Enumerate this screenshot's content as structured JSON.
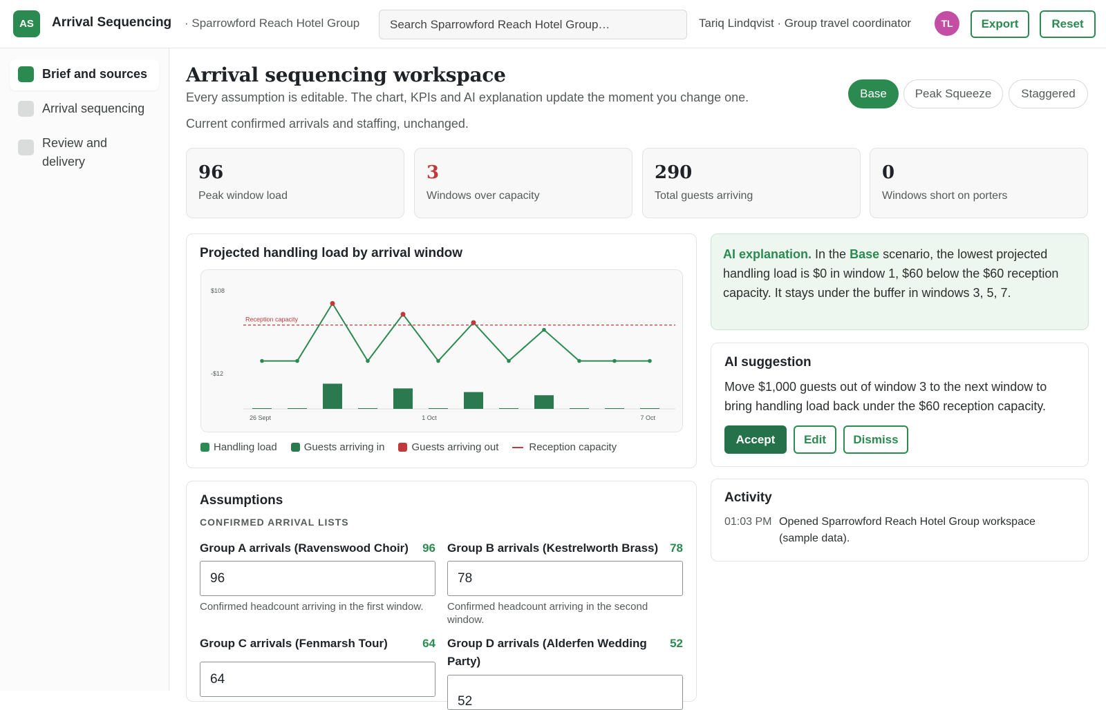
{
  "header": {
    "logo_initials": "AS",
    "app_title": "Arrival Sequencing",
    "org_crumb": "· Sparrowford Reach Hotel Group",
    "search_placeholder": "Search Sparrowford Reach Hotel Group…",
    "user_text": "Tariq Lindqvist · Group travel coordinator",
    "avatar_initials": "TL",
    "export_label": "Export",
    "reset_label": "Reset"
  },
  "sidebar": {
    "items": [
      {
        "label": "Brief and sources",
        "active": true
      },
      {
        "label": "Arrival sequencing",
        "active": false
      },
      {
        "label": "Review and delivery",
        "active": false
      }
    ]
  },
  "main": {
    "title": "Arrival sequencing workspace",
    "subtitle": "Every assumption is editable. The chart, KPIs and AI explanation update the moment you change one.",
    "scenario_desc": "Current confirmed arrivals and staffing, unchanged.",
    "scenarios": [
      "Base",
      "Peak Squeeze",
      "Staggered"
    ],
    "active_scenario": "Base"
  },
  "kpis": [
    {
      "value": "96",
      "label": "Peak window load",
      "alert": false
    },
    {
      "value": "3",
      "label": "Windows over capacity",
      "alert": true
    },
    {
      "value": "290",
      "label": "Total guests arriving",
      "alert": false
    },
    {
      "value": "0",
      "label": "Windows short on porters",
      "alert": false
    }
  ],
  "chart_card": {
    "title": "Projected handling load by arrival window",
    "legend": [
      "Handling load",
      "Guests arriving in",
      "Guests arriving out",
      "Reception capacity"
    ]
  },
  "chart_data": {
    "type": "line",
    "title": "Projected handling load by arrival window",
    "y_tick_labels": [
      "$108",
      "-$12"
    ],
    "x_tick_labels": [
      "26 Sept",
      "1 Oct",
      "7 Oct"
    ],
    "ylim": [
      -12,
      108
    ],
    "capacity_label": "Reception capacity",
    "capacity": 60,
    "series": [
      {
        "name": "Handling load",
        "type": "line",
        "values": [
          0,
          0,
          96,
          0,
          78,
          0,
          64,
          0,
          52,
          0,
          0,
          0
        ]
      },
      {
        "name": "Guests arriving in",
        "type": "bar",
        "values": [
          0,
          0,
          96,
          0,
          78,
          0,
          64,
          0,
          52,
          0,
          0,
          0
        ]
      }
    ],
    "over_capacity_points": [
      2,
      4,
      6
    ],
    "grid": false,
    "legend_position": "bottom",
    "colors": {
      "line": "#2b8a4f",
      "bar": "#2b7a4f",
      "alert": "#c0393b",
      "capacity": "#c0393b"
    }
  },
  "ai_explanation": {
    "lead": "AI explanation.",
    "t1": " In the ",
    "scenario": "Base",
    "t2": " scenario, the lowest projected handling load is $0 in window 1, $60 below the $60 reception capacity. It stays under the buffer in windows 3, 5, 7."
  },
  "ai_suggestion": {
    "title": "AI suggestion",
    "text": "Move $1,000 guests out of window 3 to the next window to bring handling load back under the $60 reception capacity.",
    "accept_label": "Accept",
    "edit_label": "Edit",
    "dismiss_label": "Dismiss"
  },
  "activity": {
    "title": "Activity",
    "items": [
      {
        "time": "01:03 PM",
        "text": "Opened Sparrowford Reach Hotel Group workspace (sample data)."
      }
    ]
  },
  "assumptions": {
    "title": "Assumptions",
    "section": "CONFIRMED ARRIVAL LISTS",
    "fields": [
      {
        "label": "Group A arrivals (Ravenswood Choir)",
        "value": "96",
        "help": "Confirmed headcount arriving in the first window."
      },
      {
        "label": "Group B arrivals (Kestrelworth Brass)",
        "value": "78",
        "help": "Confirmed headcount arriving in the second window."
      },
      {
        "label": "Group C arrivals (Fenmarsh Tour)",
        "value": "64",
        "help": ""
      },
      {
        "label": "Group D arrivals (Alderfen Wedding Party)",
        "value": "52",
        "help": ""
      }
    ]
  },
  "colors": {
    "accent": "#2b8a4f",
    "alert": "#c0393b",
    "avatar": "#c54ea5"
  }
}
